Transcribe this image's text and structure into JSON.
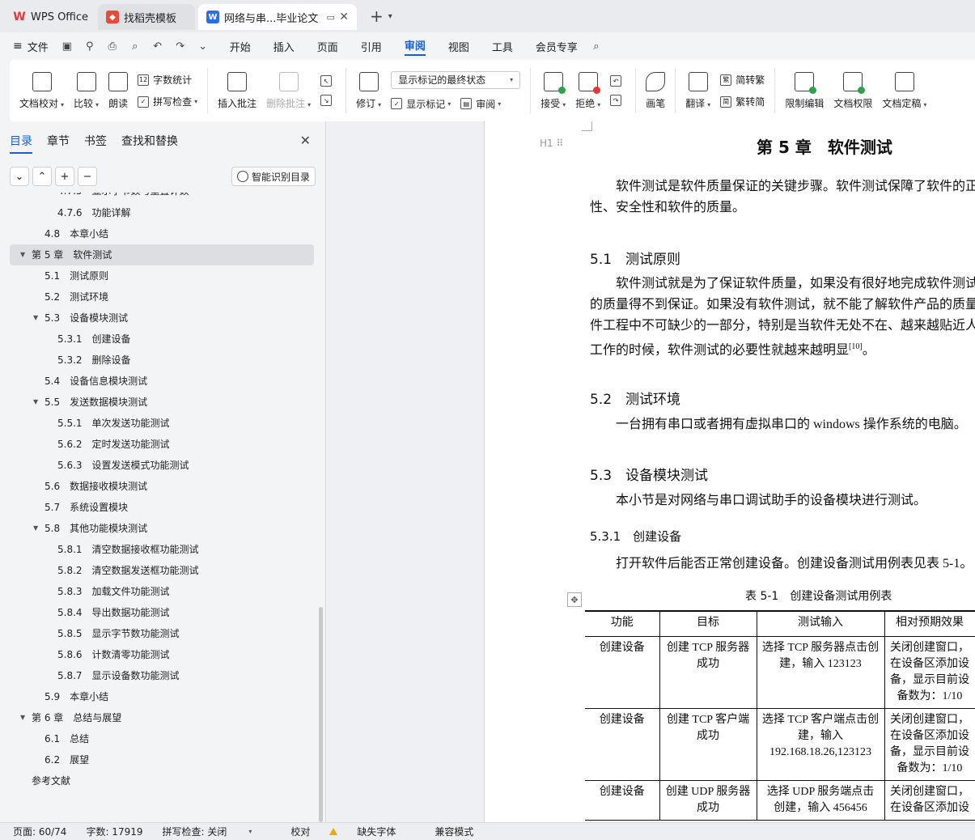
{
  "tabs": {
    "wps": "WPS Office",
    "template": "找稻壳模板",
    "document": "网络与串...毕业论文"
  },
  "menu": {
    "file": "文件",
    "items": [
      "开始",
      "插入",
      "页面",
      "引用",
      "审阅",
      "视图",
      "工具",
      "会员专享"
    ],
    "active": "审阅"
  },
  "ribbon": {
    "doc_check": "文档校对",
    "compare": "比较",
    "read_aloud": "朗读",
    "word_count": "字数统计",
    "spell_check": "拼写检查",
    "insert_comment": "插入批注",
    "delete_comment": "删除批注",
    "revise": "修订",
    "markup_mode": "显示标记的最终状态",
    "show_markup": "显示标记",
    "review": "审阅",
    "accept": "接受",
    "reject": "拒绝",
    "pen": "画笔",
    "translate": "翻译",
    "to_traditional": "简转繁",
    "to_simplified": "繁转简",
    "restrict_edit": "限制编辑",
    "doc_permission": "文档权限",
    "finalize": "文档定稿"
  },
  "nav": {
    "tabs": [
      "目录",
      "章节",
      "书签",
      "查找和替换"
    ],
    "smart_toc": "智能识别目录",
    "toc": [
      {
        "num": "4.7.5",
        "label": "显示字节数与重置计数",
        "level": 3,
        "cut": true
      },
      {
        "num": "4.7.6",
        "label": "功能详解",
        "level": 3
      },
      {
        "num": "4.8",
        "label": "本章小结",
        "level": 2
      },
      {
        "num": "第 5 章",
        "label": "软件测试",
        "level": 1,
        "expanded": true,
        "selected": true
      },
      {
        "num": "5.1",
        "label": "测试原则",
        "level": 2
      },
      {
        "num": "5.2",
        "label": "测试环境",
        "level": 2
      },
      {
        "num": "5.3",
        "label": "设备模块测试",
        "level": 2,
        "expanded": true
      },
      {
        "num": "5.3.1",
        "label": "创建设备",
        "level": 3
      },
      {
        "num": "5.3.2",
        "label": "删除设备",
        "level": 3
      },
      {
        "num": "5.4",
        "label": "设备信息模块测试",
        "level": 2
      },
      {
        "num": "5.5",
        "label": "发送数据模块测试",
        "level": 2,
        "expanded": true
      },
      {
        "num": "5.5.1",
        "label": "单次发送功能测试",
        "level": 3
      },
      {
        "num": "5.6.2",
        "label": "定时发送功能测试",
        "level": 3
      },
      {
        "num": "5.6.3",
        "label": "设置发送模式功能测试",
        "level": 3
      },
      {
        "num": "5.6",
        "label": "数据接收模块测试",
        "level": 2
      },
      {
        "num": "5.7",
        "label": "系统设置模块",
        "level": 2
      },
      {
        "num": "5.8",
        "label": "其他功能模块测试",
        "level": 2,
        "expanded": true
      },
      {
        "num": "5.8.1",
        "label": "清空数据接收框功能测试",
        "level": 3
      },
      {
        "num": "5.8.2",
        "label": "清空数据发送框功能测试",
        "level": 3
      },
      {
        "num": "5.8.3",
        "label": "加载文件功能测试",
        "level": 3
      },
      {
        "num": "5.8.4",
        "label": "导出数据功能测试",
        "level": 3
      },
      {
        "num": "5.8.5",
        "label": "显示字节数功能测试",
        "level": 3
      },
      {
        "num": "5.8.6",
        "label": "计数清零功能测试",
        "level": 3
      },
      {
        "num": "5.8.7",
        "label": "显示设备数功能测试",
        "level": 3
      },
      {
        "num": "5.9",
        "label": "本章小结",
        "level": 2
      },
      {
        "num": "第 6 章",
        "label": "总结与展望",
        "level": 1,
        "expanded": true
      },
      {
        "num": "6.1",
        "label": "总结",
        "level": 2
      },
      {
        "num": "6.2",
        "label": "展望",
        "level": 2
      },
      {
        "num": "",
        "label": "参考文献",
        "level": 1
      }
    ]
  },
  "document": {
    "heading_marker": "H1",
    "chapter_title": "第 5 章　软件测试",
    "intro_line1": "软件测试是软件质量保证的关键步骤。软件测试保障了软件的正",
    "intro_line2": "性、安全性和软件的质量。",
    "s51_title": "5.1　测试原则",
    "s51_line1": "软件测试就是为了保证软件质量，如果没有很好地完成软件测试",
    "s51_line2": "的质量得不到保证。如果没有软件测试，就不能了解软件产品的质量",
    "s51_line3": "件工程中不可缺少的一部分，特别是当软件无处不在、越来越贴近人",
    "s51_line4": "工作的时候，软件测试的必要性就越来越明显",
    "s51_ref": "[10]",
    "s51_end": "。",
    "s52_title": "5.2　测试环境",
    "s52_line1": "一台拥有串口或者拥有虚拟串口的 windows 操作系统的电脑。",
    "s53_title": "5.3　设备模块测试",
    "s53_line1": "本小节是对网络与串口调试助手的设备模块进行测试。",
    "s531_title": "5.3.1　创建设备",
    "s531_line1": "打开软件后能否正常创建设备。创建设备测试用例表见表 5-1。",
    "table_caption": "表 5-1　创建设备测试用例表",
    "table": {
      "headers": [
        "功能",
        "目标",
        "测试输入",
        "相对预期效果"
      ],
      "rows": [
        [
          "创建设备",
          "创建 TCP 服务器成功",
          "选择 TCP 服务器点击创建，输入 123123",
          "关闭创建窗口，在设备区添加设备，显示目前设备数为：1/10"
        ],
        [
          "创建设备",
          "创建 TCP 客户端成功",
          "选择 TCP 客户端点击创建，输入 192.168.18.26,123123",
          "关闭创建窗口，在设备区添加设备，显示目前设备数为：1/10"
        ],
        [
          "创建设备",
          "创建 UDP 服务器成功",
          "选择 UDP 服务端点击创建，输入 456456",
          "关闭创建窗口，在设备区添加设"
        ]
      ]
    }
  },
  "status": {
    "page": "页面: 60/74",
    "words": "字数: 17919",
    "spell": "拼写检查: 关闭",
    "proof": "校对",
    "missing_font": "缺失字体",
    "compat": "兼容模式"
  }
}
